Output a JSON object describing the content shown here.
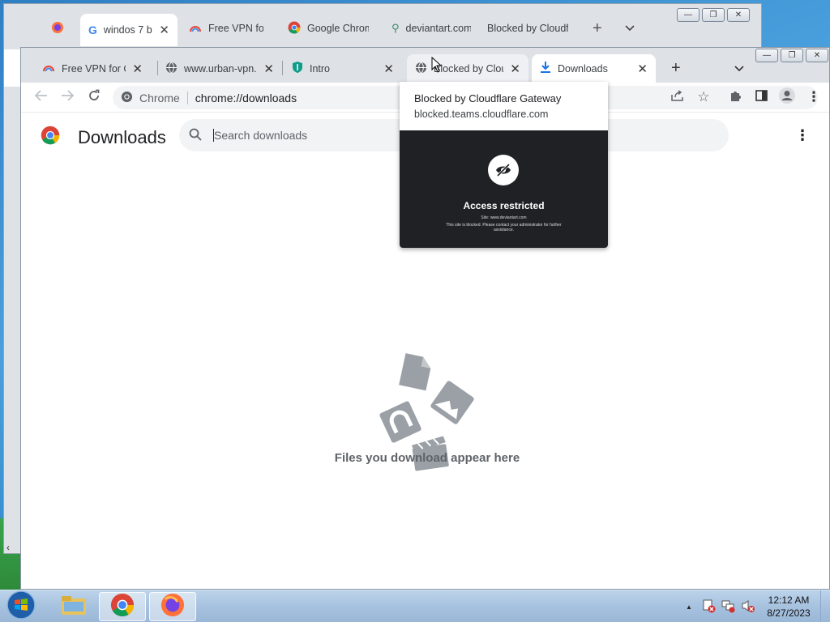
{
  "back_window": {
    "tabs": [
      {
        "label": "",
        "icon": "firefox-icon"
      },
      {
        "label": "windos 7 bu",
        "icon": "google-g-icon",
        "active": true
      },
      {
        "label": "Free VPN for C",
        "icon": "rainbow-icon"
      },
      {
        "label": "Google Chrom",
        "icon": "chrome-icon"
      },
      {
        "label": "deviantart.com",
        "icon": "deviantart-icon"
      },
      {
        "label": "Blocked by Cloudfl",
        "icon": ""
      }
    ],
    "new_tab_label": "+",
    "tab_search_label": "⌄"
  },
  "front_window": {
    "tabs": [
      {
        "label": "Free VPN for Chr",
        "icon": "rainbow-icon"
      },
      {
        "label": "www.urban-vpn.c",
        "icon": "globe-icon"
      },
      {
        "label": "Intro",
        "icon": "shield-icon"
      },
      {
        "label": "Blocked by Clouc",
        "icon": "globe-icon"
      },
      {
        "label": "Downloads",
        "icon": "download-icon",
        "active": true
      }
    ],
    "new_tab_label": "+",
    "omnibox": {
      "site": "Chrome",
      "url": "chrome://downloads"
    }
  },
  "downloads_page": {
    "title": "Downloads",
    "search_placeholder": "Search downloads",
    "empty_message": "Files you download appear here"
  },
  "hover_card": {
    "title": "Blocked by Cloudflare Gateway",
    "url": "blocked.teams.cloudflare.com",
    "preview": {
      "heading": "Access restricted",
      "site_line": "Site: www.deviantart.com",
      "body_line": "This site is blocked. Please contact your administrator for further assistance."
    }
  },
  "taskbar": {
    "time": "12:12 AM",
    "date": "8/27/2023",
    "tray_chevron": "▲"
  },
  "colors": {
    "tab_strip": "#dee1e6",
    "accent_blue": "#1a73e8",
    "preview_bg": "#202124"
  }
}
